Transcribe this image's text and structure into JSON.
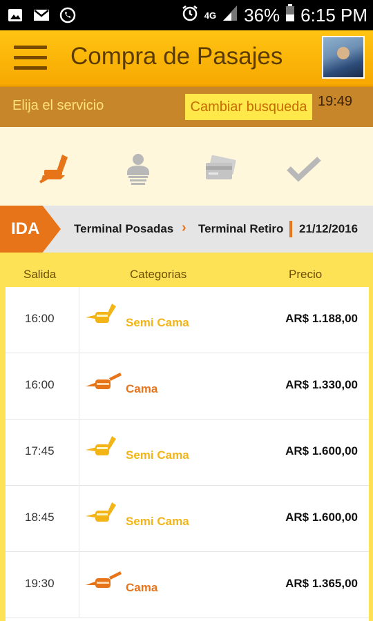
{
  "status_bar": {
    "left_icons": [
      "image-icon",
      "gmail-icon",
      "whatsapp-icon"
    ],
    "network": "4G",
    "battery": "36%",
    "time": "6:15 PM"
  },
  "app_bar": {
    "title": "Compra de Pasajes"
  },
  "service_bar": {
    "label": "Elija el servicio",
    "change_button": "Cambiar busqueda",
    "time": "19:49"
  },
  "steps": [
    {
      "name": "seat-icon",
      "active": true
    },
    {
      "name": "passenger-icon",
      "active": false
    },
    {
      "name": "payment-card-icon",
      "active": false
    },
    {
      "name": "checkmark-icon",
      "active": false
    }
  ],
  "route": {
    "direction": "IDA",
    "origin": "Terminal Posadas",
    "destination": "Terminal Retiro",
    "date": "21/12/2016"
  },
  "table": {
    "headers": {
      "salida": "Salida",
      "categorias": "Categorias",
      "precio": "Precio"
    },
    "rows": [
      {
        "time": "16:00",
        "category": "Semi Cama",
        "price": "AR$ 1.188,00"
      },
      {
        "time": "16:00",
        "category": "Cama",
        "price": "AR$ 1.330,00"
      },
      {
        "time": "17:45",
        "category": "Semi Cama",
        "price": "AR$ 1.600,00"
      },
      {
        "time": "18:45",
        "category": "Semi Cama",
        "price": "AR$ 1.600,00"
      },
      {
        "time": "19:30",
        "category": "Cama",
        "price": "AR$ 1.365,00"
      }
    ]
  },
  "colors": {
    "semi_cama": "#f2b417",
    "cama": "#e8741a",
    "accent": "#f7a800"
  }
}
